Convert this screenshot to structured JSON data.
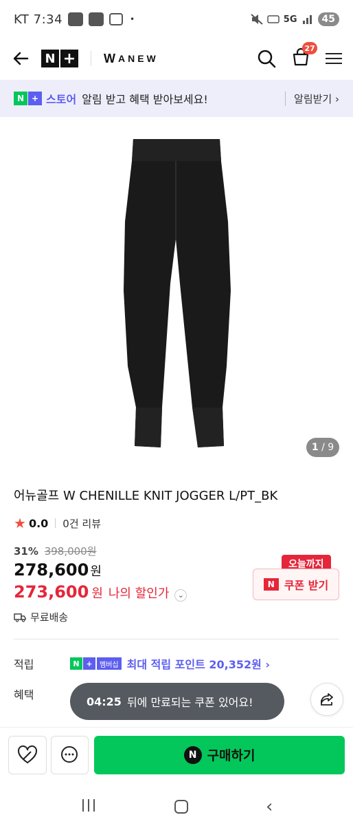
{
  "status_bar": {
    "carrier_time": "KT 7:34",
    "dot": "•",
    "network": "5G",
    "battery": "45"
  },
  "header": {
    "logo_n": "N",
    "logo_plus": "+",
    "brand": "ANEW",
    "brand_mark": "W",
    "cart_count": "27"
  },
  "store_banner": {
    "n": "N",
    "plus": "+",
    "store_name": "스토어",
    "message": "알림 받고 혜택 받아보세요!",
    "alarm_label": "알림받기 ›"
  },
  "gallery": {
    "current": "1",
    "total": "/ 9"
  },
  "product": {
    "title": "어뉴골프 W CHENILLE KNIT JOGGER L/PT_BK",
    "rating": "0.0",
    "reviews": "0건 리뷰",
    "discount_rate": "31%",
    "original_price": "398,000원",
    "price": "278,600",
    "price_unit": "원",
    "my_price": "273,600",
    "my_price_unit": "원",
    "my_price_label": "나의 할인가",
    "shipping": "무료배송"
  },
  "coupon": {
    "tag": "오늘까지",
    "button_label": "쿠폰 받기",
    "n": "N"
  },
  "points": {
    "label": "적립",
    "n": "N",
    "plus": "+",
    "member": "멤버십",
    "text": "최대 적립 포인트 20,352원 ›"
  },
  "benefit": {
    "label": "혜택"
  },
  "toast": {
    "time": "04:25",
    "message": "뒤에 만료되는 쿠폰 있어요!"
  },
  "action_bar": {
    "buy_label": "구매하기",
    "n": "N"
  },
  "colors": {
    "naver_green": "#03c75a",
    "store_purple": "#5c5ef0",
    "price_red": "#e5263a"
  }
}
